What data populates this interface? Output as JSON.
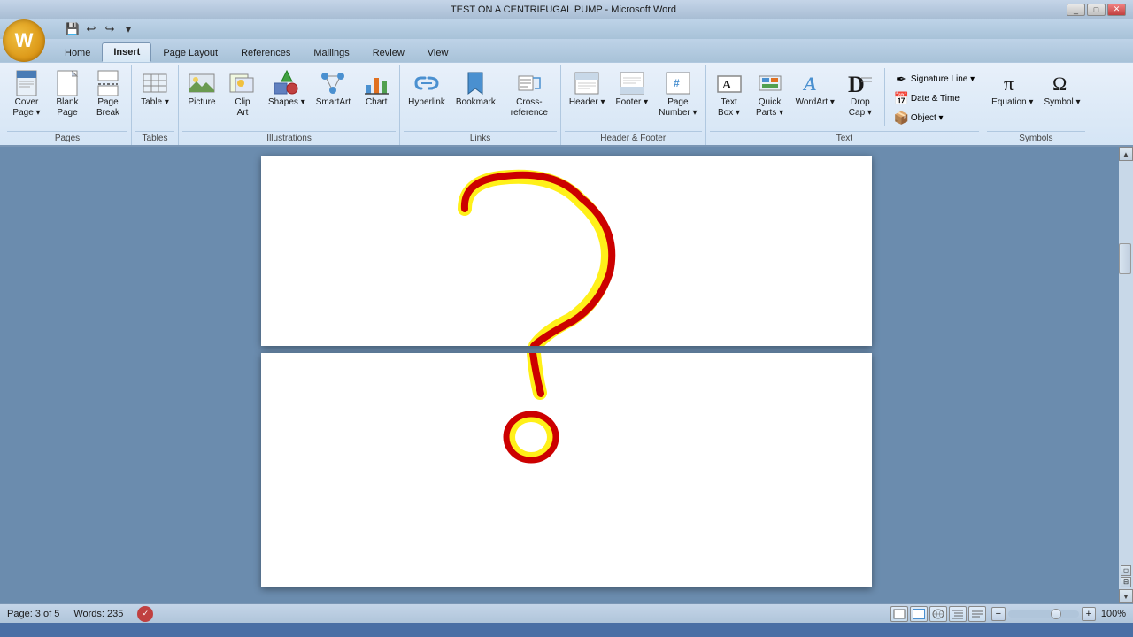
{
  "titleBar": {
    "title": "TEST ON A CENTRIFUGAL PUMP - Microsoft Word",
    "minimize": "🗕",
    "maximize": "🗖",
    "close": "✕"
  },
  "quickAccess": {
    "save": "💾",
    "undo": "↩",
    "redo": "↪",
    "more": "▾"
  },
  "tabs": [
    {
      "id": "home",
      "label": "Home",
      "active": false
    },
    {
      "id": "insert",
      "label": "Insert",
      "active": true
    },
    {
      "id": "pagelayout",
      "label": "Page Layout",
      "active": false
    },
    {
      "id": "references",
      "label": "References",
      "active": false
    },
    {
      "id": "mailings",
      "label": "Mailings",
      "active": false
    },
    {
      "id": "review",
      "label": "Review",
      "active": false
    },
    {
      "id": "view",
      "label": "View",
      "active": false
    }
  ],
  "ribbon": {
    "groups": [
      {
        "id": "pages",
        "label": "Pages",
        "items": [
          {
            "id": "cover-page",
            "icon": "📄",
            "label": "Cover\nPage ▾"
          },
          {
            "id": "blank-page",
            "icon": "📃",
            "label": "Blank\nPage"
          },
          {
            "id": "page-break",
            "icon": "📑",
            "label": "Page\nBreak"
          }
        ]
      },
      {
        "id": "tables",
        "label": "Tables",
        "items": [
          {
            "id": "table",
            "icon": "⊞",
            "label": "Table ▾"
          }
        ]
      },
      {
        "id": "illustrations",
        "label": "Illustrations",
        "items": [
          {
            "id": "picture",
            "icon": "🖼",
            "label": "Picture"
          },
          {
            "id": "clip-art",
            "icon": "✂",
            "label": "Clip\nArt"
          },
          {
            "id": "shapes",
            "icon": "◻",
            "label": "Shapes ▾"
          },
          {
            "id": "smartart",
            "icon": "🔷",
            "label": "SmartArt"
          },
          {
            "id": "chart",
            "icon": "📊",
            "label": "Chart"
          }
        ]
      },
      {
        "id": "links",
        "label": "Links",
        "items": [
          {
            "id": "hyperlink",
            "icon": "🔗",
            "label": "Hyperlink"
          },
          {
            "id": "bookmark",
            "icon": "🔖",
            "label": "Bookmark"
          },
          {
            "id": "cross-ref",
            "icon": "↗",
            "label": "Cross-reference"
          }
        ]
      },
      {
        "id": "header-footer",
        "label": "Header & Footer",
        "items": [
          {
            "id": "header",
            "icon": "▭",
            "label": "Header ▾"
          },
          {
            "id": "footer",
            "icon": "▭",
            "label": "Footer ▾"
          },
          {
            "id": "page-number",
            "icon": "#",
            "label": "Page\nNumber ▾"
          }
        ]
      },
      {
        "id": "text",
        "label": "Text",
        "items": [
          {
            "id": "text-box",
            "icon": "A",
            "label": "Text\nBox ▾"
          },
          {
            "id": "quick-parts",
            "icon": "⚡",
            "label": "Quick\nParts ▾"
          },
          {
            "id": "wordart",
            "icon": "𝒜",
            "label": "WordArt ▾"
          },
          {
            "id": "drop-cap",
            "icon": "Ꭰ",
            "label": "Drop\nCap ▾"
          }
        ]
      },
      {
        "id": "text-right",
        "label": "",
        "items": [
          {
            "id": "signature-line",
            "label": "Signature Line ▾"
          },
          {
            "id": "date-time",
            "label": "Date & Time"
          },
          {
            "id": "object",
            "label": "Object ▾"
          }
        ]
      },
      {
        "id": "symbols",
        "label": "Symbols",
        "items": [
          {
            "id": "equation",
            "icon": "π",
            "label": "Equation ▾"
          },
          {
            "id": "symbol",
            "icon": "Ω",
            "label": "Symbol ▾"
          }
        ]
      }
    ]
  },
  "statusBar": {
    "page": "Page: 3 of 5",
    "words": "Words: 235",
    "language": "🌐",
    "zoom": "100%",
    "zoomIn": "+",
    "zoomOut": "-"
  },
  "drawing": {
    "page1": {
      "description": "Question mark drawing with red and yellow lines - upper portion"
    },
    "page2": {
      "description": "Question mark dot with red and yellow circle - lower portion"
    }
  }
}
